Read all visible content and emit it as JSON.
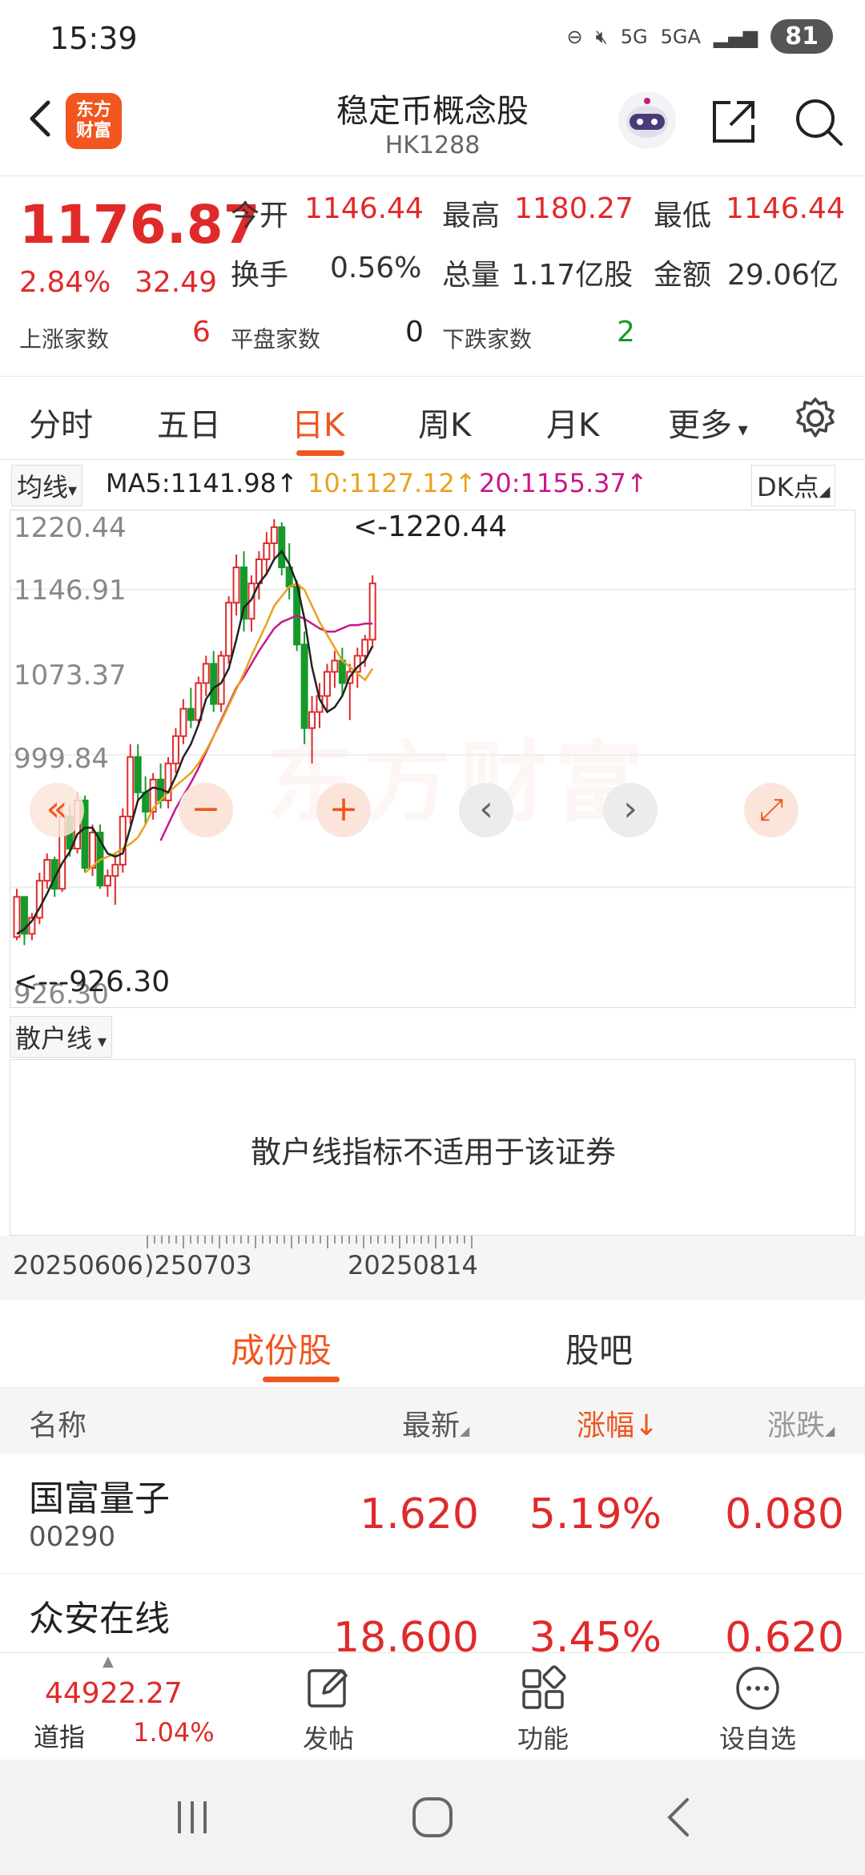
{
  "status_bar": {
    "time": "15:39",
    "network1": "5G",
    "network2": "5GA",
    "battery": "81"
  },
  "header": {
    "logo_text_line1": "东方",
    "logo_text_line2": "财富",
    "title": "稳定币概念股",
    "code": "HK1288"
  },
  "quote": {
    "price": "1176.87",
    "change_pct": "2.84%",
    "change": "32.49",
    "open_label": "今开",
    "open": "1146.44",
    "high_label": "最高",
    "high": "1180.27",
    "low_label": "最低",
    "low": "1146.44",
    "turnover_label": "换手",
    "turnover": "0.56%",
    "volume_label": "总量",
    "volume": "1.17亿股",
    "amount_label": "金额",
    "amount": "29.06亿",
    "up_label": "上涨家数",
    "up_count": "6",
    "flat_label": "平盘家数",
    "flat_count": "0",
    "down_label": "下跌家数",
    "down_count": "2"
  },
  "tabs": [
    {
      "label": "分时"
    },
    {
      "label": "五日"
    },
    {
      "label": "日K"
    },
    {
      "label": "周K"
    },
    {
      "label": "月K"
    },
    {
      "label": "更多"
    }
  ],
  "ma_row": {
    "selector": "均线",
    "ma5": "MA5:1141.98↑",
    "ma10": "10:1127.12↑",
    "ma20": "20:1155.37↑",
    "dk": "DK点"
  },
  "chart_data": {
    "type": "candlestick",
    "y_ticks": [
      "1220.44",
      "1146.91",
      "1073.37",
      "999.84",
      "926.30"
    ],
    "ylim": [
      926.3,
      1220.44
    ],
    "max_label": "<-1220.44",
    "min_label": "<---926.30",
    "watermark": "东方财富",
    "candles": [
      [
        960,
        990,
        958,
        985
      ],
      [
        985,
        985,
        955,
        962
      ],
      [
        962,
        975,
        958,
        972
      ],
      [
        972,
        1000,
        968,
        995
      ],
      [
        995,
        1012,
        990,
        1008
      ],
      [
        1008,
        1010,
        985,
        990
      ],
      [
        990,
        1040,
        988,
        1035
      ],
      [
        1035,
        1042,
        1010,
        1015
      ],
      [
        1015,
        1050,
        1012,
        1045
      ],
      [
        1045,
        1048,
        1000,
        1003
      ],
      [
        1003,
        1030,
        998,
        1025
      ],
      [
        1025,
        1030,
        990,
        992
      ],
      [
        992,
        1002,
        985,
        998
      ],
      [
        998,
        1012,
        980,
        1005
      ],
      [
        1005,
        1040,
        1000,
        1035
      ],
      [
        1035,
        1080,
        1030,
        1072
      ],
      [
        1072,
        1080,
        1045,
        1050
      ],
      [
        1050,
        1060,
        1030,
        1038
      ],
      [
        1038,
        1062,
        1033,
        1058
      ],
      [
        1058,
        1068,
        1040,
        1045
      ],
      [
        1045,
        1072,
        1040,
        1068
      ],
      [
        1068,
        1090,
        1062,
        1085
      ],
      [
        1085,
        1108,
        1080,
        1102
      ],
      [
        1102,
        1115,
        1090,
        1095
      ],
      [
        1095,
        1122,
        1092,
        1118
      ],
      [
        1118,
        1135,
        1110,
        1130
      ],
      [
        1130,
        1138,
        1100,
        1105
      ],
      [
        1105,
        1138,
        1100,
        1135
      ],
      [
        1135,
        1172,
        1130,
        1168
      ],
      [
        1168,
        1198,
        1160,
        1190
      ],
      [
        1190,
        1200,
        1150,
        1158
      ],
      [
        1158,
        1185,
        1150,
        1180
      ],
      [
        1180,
        1200,
        1170,
        1195
      ],
      [
        1195,
        1212,
        1185,
        1205
      ],
      [
        1205,
        1220,
        1195,
        1215
      ],
      [
        1215,
        1218,
        1185,
        1190
      ],
      [
        1190,
        1205,
        1170,
        1178
      ],
      [
        1178,
        1182,
        1138,
        1142
      ],
      [
        1142,
        1150,
        1080,
        1090
      ],
      [
        1090,
        1110,
        1068,
        1100
      ],
      [
        1100,
        1118,
        1090,
        1110
      ],
      [
        1110,
        1130,
        1100,
        1125
      ],
      [
        1125,
        1138,
        1115,
        1132
      ],
      [
        1132,
        1140,
        1110,
        1118
      ],
      [
        1118,
        1130,
        1095,
        1125
      ],
      [
        1125,
        1140,
        1115,
        1135
      ],
      [
        1135,
        1148,
        1128,
        1145
      ],
      [
        1145,
        1185,
        1140,
        1180
      ]
    ],
    "ma5": [
      962,
      965,
      970,
      978,
      987,
      997,
      1006,
      1013,
      1024,
      1028,
      1028,
      1020,
      1012,
      1010,
      1012,
      1028,
      1045,
      1050,
      1053,
      1052,
      1050,
      1060,
      1072,
      1080,
      1092,
      1108,
      1115,
      1118,
      1127,
      1145,
      1165,
      1170,
      1180,
      1186,
      1195,
      1200,
      1192,
      1180,
      1158,
      1128,
      1108,
      1100,
      1103,
      1110,
      1122,
      1128,
      1132,
      1141
    ],
    "ma10": [
      null,
      null,
      null,
      null,
      null,
      null,
      null,
      null,
      null,
      1000,
      1004,
      1008,
      1010,
      1012,
      1015,
      1018,
      1022,
      1030,
      1040,
      1045,
      1050,
      1054,
      1058,
      1062,
      1068,
      1076,
      1085,
      1094,
      1104,
      1114,
      1124,
      1135,
      1145,
      1155,
      1166,
      1172,
      1178,
      1180,
      1176,
      1166,
      1156,
      1148,
      1140,
      1132,
      1128,
      1124,
      1120,
      1127
    ],
    "ma20": [
      null,
      null,
      null,
      null,
      null,
      null,
      null,
      null,
      null,
      null,
      null,
      null,
      null,
      null,
      null,
      null,
      null,
      null,
      null,
      1020,
      1030,
      1040,
      1048,
      1056,
      1065,
      1075,
      1085,
      1095,
      1105,
      1115,
      1122,
      1130,
      1138,
      1145,
      1152,
      1156,
      1158,
      1160,
      1158,
      1155,
      1152,
      1150,
      1150,
      1152,
      1154,
      1154,
      1155,
      1155
    ],
    "x_dates": [
      "20250606",
      "20250703",
      "20250814"
    ]
  },
  "chart_buttons": [
    "«",
    "−",
    "+",
    "‹",
    "›",
    "⤢"
  ],
  "indicator": {
    "selector": "散户线",
    "message": "散户线指标不适用于该证券"
  },
  "dates": {
    "d1": "20250606",
    "d2": ")250703",
    "d3": "20250814"
  },
  "sub_tabs": [
    {
      "label": "成份股"
    },
    {
      "label": "股吧"
    }
  ],
  "table": {
    "headers": {
      "name": "名称",
      "latest": "最新",
      "change_pct": "涨幅↓",
      "change": "涨跌"
    },
    "rows": [
      {
        "name": "国富量子",
        "code": "00290",
        "latest": "1.620",
        "change_pct": "5.19%",
        "change": "0.080"
      },
      {
        "name": "众安在线",
        "code": "",
        "latest": "18.600",
        "change_pct": "3.45%",
        "change": "0.620"
      }
    ]
  },
  "bottom_bar": {
    "index_value": "44922.27",
    "index_name": "道指",
    "index_pct": "1.04%",
    "post_label": "发帖",
    "func_label": "功能",
    "watch_label": "设自选"
  },
  "colors": {
    "accent": "#f0561e",
    "up": "#e02a2a",
    "down": "#159a2a",
    "ma5": "#222222",
    "ma10": "#e8a21e",
    "ma20": "#c8178a"
  }
}
